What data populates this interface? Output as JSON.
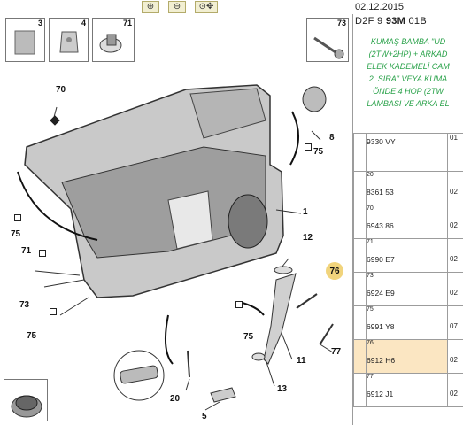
{
  "toolbar": {
    "zoom_in_icon": "zoom-in-icon",
    "zoom_out_icon": "zoom-out-icon",
    "zoom_fit_icon": "zoom-fit-icon"
  },
  "thumbnails": [
    {
      "num": "3"
    },
    {
      "num": "4"
    },
    {
      "num": "71"
    },
    {
      "num": "73"
    }
  ],
  "callouts": {
    "c70": "70",
    "c8": "8",
    "c75a": "75",
    "c1": "1",
    "c75b": "75",
    "c71": "71",
    "c73": "73",
    "c75c": "75",
    "c12": "12",
    "c76": "76",
    "c75d": "75",
    "c11": "11",
    "c77": "77",
    "c13": "13",
    "c20": "20",
    "c5": "5"
  },
  "right": {
    "date": "02.12.2015",
    "code_prefix": "D2F 9 ",
    "code_bold": "93M",
    "code_suffix": " 01B",
    "description": [
      "KUMAŞ BAMBA \"UD",
      "(2TW+2HP) + ARKAD",
      "ELEK KADEMELİ CAM",
      "2. SIRA\" VEYA KUMA",
      "ÖNDE 4 HOP (2TW",
      "LAMBASI VE ARKA EL"
    ]
  },
  "parts": [
    {
      "ref": "",
      "part": "9330 VY",
      "qty": "01"
    },
    {
      "ref": "20",
      "part": "8361 53",
      "qty": "02"
    },
    {
      "ref": "70",
      "part": "6943 86",
      "qty": "02"
    },
    {
      "ref": "71",
      "part": "6990 E7",
      "qty": "02"
    },
    {
      "ref": "73",
      "part": "6924 E9",
      "qty": "02"
    },
    {
      "ref": "75",
      "part": "6991 Y8",
      "qty": "07"
    },
    {
      "ref": "76",
      "part": "6912 H6",
      "qty": "02"
    },
    {
      "ref": "77",
      "part": "6912 J1",
      "qty": "02"
    }
  ],
  "colors": {
    "description_text": "#2aa24a",
    "selected_row": "#fbe6c2",
    "highlight_callout": "#f1d47c"
  }
}
